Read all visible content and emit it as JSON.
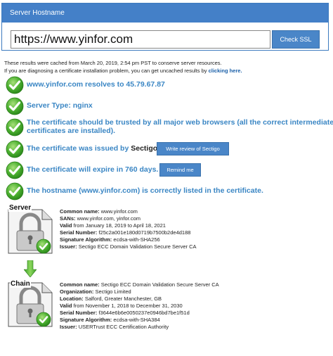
{
  "header": {
    "title": "Server Hostname"
  },
  "search": {
    "value": "https://www.yinfor.com",
    "button_label": "Check SSL"
  },
  "cache_note": {
    "line1": "These results were cached from March 20, 2019, 2:54 pm PST to conserve server resources.",
    "line2_prefix": "If you are diagnosing a certificate installation problem, you can get uncached results by ",
    "link": "clicking here.",
    "link_suffix": ""
  },
  "checks": [
    {
      "text": "www.yinfor.com resolves to 45.79.67.87"
    },
    {
      "text": "Server Type: nginx"
    },
    {
      "text_line1": "The certificate should be trusted by all major web browsers (all the correct intermediate",
      "text_line2": "certificates are installed)."
    },
    {
      "text": "The certificate was issued by ",
      "issuer": "Sectigo.",
      "button": "Write review of Sectigo"
    },
    {
      "text": "The certificate will expire in 760 days.",
      "button": "Remind me"
    },
    {
      "text": "The hostname (www.yinfor.com) is correctly listed in the certificate."
    }
  ],
  "server_cert": {
    "label": "Server",
    "fields": [
      {
        "label": "Common name:",
        "value": "www.yinfor.com"
      },
      {
        "label": "SANs:",
        "value": "www.yinfor.com, yinfor.com"
      },
      {
        "label": "Valid",
        "value": "from January 18, 2019 to April 18, 2021"
      },
      {
        "label": "Serial Number:",
        "value": "f25c2a001e180d0719b7500b2de4d188"
      },
      {
        "label": "Signature Algorithm:",
        "value": "ecdsa-with-SHA256"
      },
      {
        "label": "Issuer:",
        "value": "Sectigo ECC Domain Validation Secure Server CA"
      }
    ]
  },
  "chain_cert": {
    "label": "Chain",
    "fields": [
      {
        "label": "Common name:",
        "value": "Sectigo ECC Domain Validation Secure Server CA"
      },
      {
        "label": "Organization:",
        "value": "Sectigo Limited"
      },
      {
        "label": "Location:",
        "value": "Salford, Greater Manchester, GB"
      },
      {
        "label": "Valid",
        "value": "from November 1, 2018 to December 31, 2030"
      },
      {
        "label": "Serial Number:",
        "value": "f3644e6b6e0050237e0946bd7be1f51d"
      },
      {
        "label": "Signature Algorithm:",
        "value": "ecdsa-with-SHA384"
      },
      {
        "label": "Issuer:",
        "value": "USERTrust ECC Certification Authority"
      }
    ]
  },
  "colors": {
    "accent": "#4480c8",
    "check_green": "#3fae2a",
    "text_blue": "#3a86c4"
  }
}
